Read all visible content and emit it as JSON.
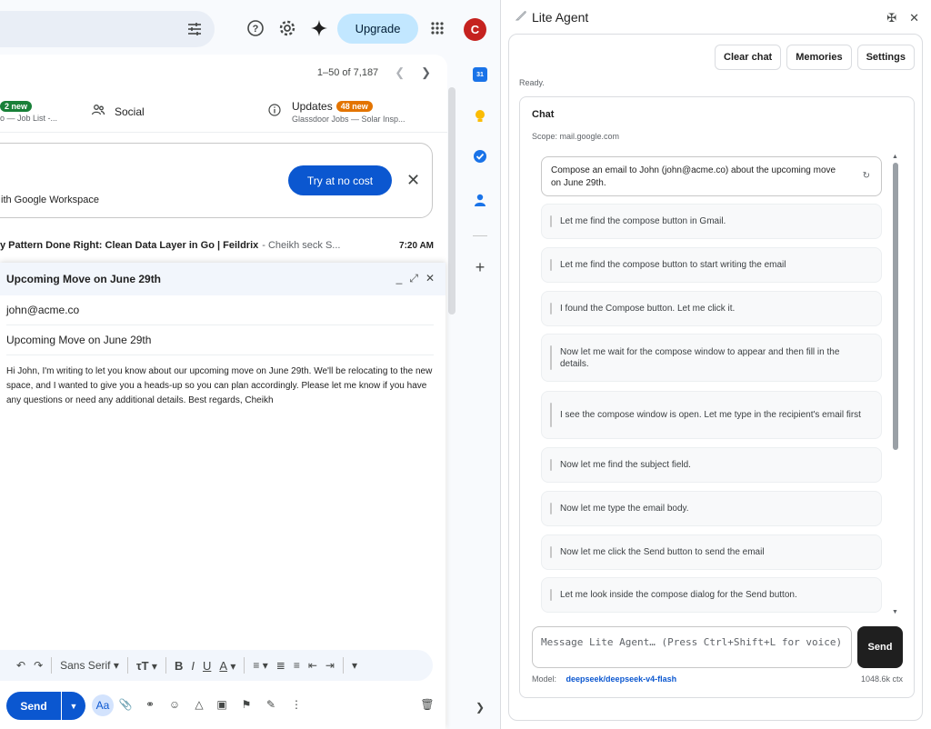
{
  "gmail": {
    "upgrade_label": "Upgrade",
    "avatar_letter": "C",
    "pager_text": "1–50 of 7,187",
    "categories": {
      "primary_badge": "2 new",
      "primary_snippet": "o — Job List -...",
      "social_label": "Social",
      "updates_label": "Updates",
      "updates_badge": "48 new",
      "updates_snippet": "Glassdoor Jobs — Solar Insp..."
    },
    "promo": {
      "text": "ith Google Workspace",
      "button_label": "Try at no cost"
    },
    "mail_row": {
      "subject": "y Pattern Done Right: Clean Data Layer in Go | Feildrix",
      "snippet": "- Cheikh seck S...",
      "time": "7:20 AM"
    },
    "compose": {
      "title": "Upcoming Move on June 29th",
      "to": "john@acme.co",
      "subject": "Upcoming Move on June 29th",
      "body": "Hi John, I'm writing to let you know about our upcoming move on June 29th. We'll be relocating to the new space, and I wanted to give you a heads-up so you can plan accordingly. Please let me know if you have any questions or need any additional details. Best regards, Cheikh",
      "font_select": "Sans Serif",
      "send_label": "Send",
      "aa_label": "Aa"
    },
    "rail": {
      "calendar_day": "31"
    }
  },
  "agent": {
    "title": "Lite Agent",
    "buttons": {
      "clear_chat": "Clear chat",
      "memories": "Memories",
      "settings": "Settings"
    },
    "status": "Ready.",
    "chat_title": "Chat",
    "scope": "Scope: mail.google.com",
    "user_message": "Compose an email to John (john@acme.co) about the upcoming move on June 29th.",
    "bot_messages": [
      "Let me find the compose button in Gmail.",
      "Let me find the compose button to start writing the email",
      "I found the Compose button. Let me click it.",
      "Now let me wait for the compose window to appear and then fill in the details.",
      "I see the compose window is open. Let me type in the recipient's email first",
      "Now let me find the subject field.",
      "Now let me type the email body.",
      "Now let me click the Send button to send the email",
      "Let me look inside the compose dialog for the Send button."
    ],
    "input_placeholder": "Message Lite Agent… (Press Ctrl+Shift+L for voice)",
    "send_label": "Send",
    "model_label": "Model:",
    "model_name": "deepseek/deepseek-v4-flash",
    "context": "1048.6k ctx"
  }
}
